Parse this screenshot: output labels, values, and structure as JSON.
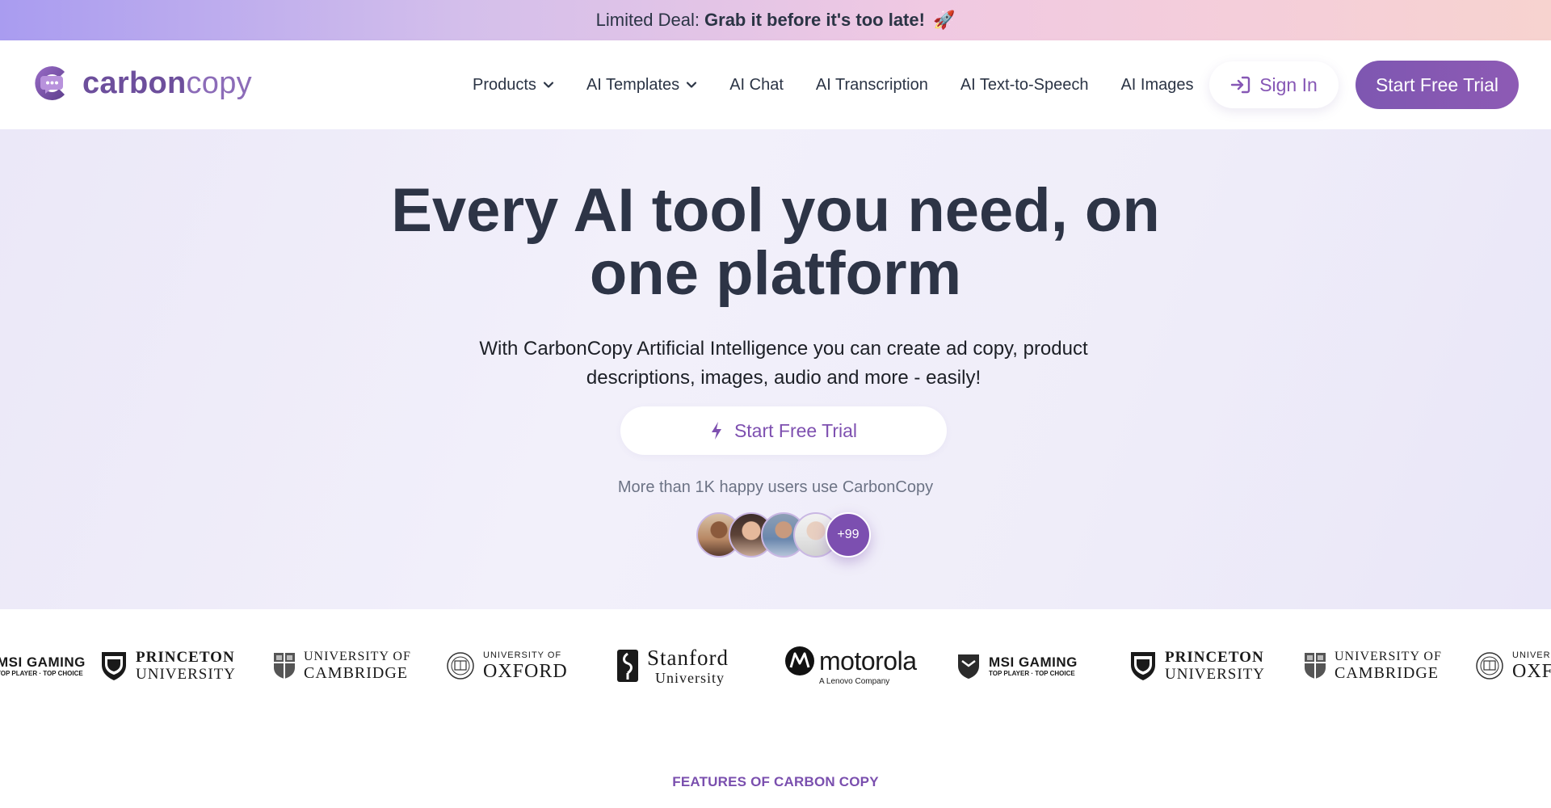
{
  "promo": {
    "prefix": "Limited Deal:",
    "highlight": "Grab it before it's too late!",
    "emoji": "🚀"
  },
  "header": {
    "logo_bold": "carbon",
    "logo_light": "copy",
    "nav": [
      {
        "label": "Products",
        "has_dropdown": true
      },
      {
        "label": "AI Templates",
        "has_dropdown": true
      },
      {
        "label": "AI Chat",
        "has_dropdown": false
      },
      {
        "label": "AI Transcription",
        "has_dropdown": false
      },
      {
        "label": "AI Text-to-Speech",
        "has_dropdown": false
      },
      {
        "label": "AI Images",
        "has_dropdown": false
      }
    ],
    "sign_in": "Sign In",
    "start_trial": "Start Free Trial"
  },
  "hero": {
    "title_line1": "Every AI tool you need, on",
    "title_line2": "one platform",
    "subtitle": "With CarbonCopy Artificial Intelligence you can create ad copy, product descriptions, images, audio and more - easily!",
    "cta": "Start Free Trial",
    "users_text": "More than 1K happy users use CarbonCopy",
    "more_users": "+99"
  },
  "logos": {
    "msi_main": "MSI GAMING",
    "msi_sub": "TOP PLAYER · TOP CHOICE",
    "princeton_l1": "PRINCETON",
    "princeton_l2": "UNIVERSITY",
    "cambridge_l1": "UNIVERSITY OF",
    "cambridge_l2": "CAMBRIDGE",
    "oxford_l1": "UNIVERSITY OF",
    "oxford_l2": "OXFORD",
    "stanford_l1": "Stanford",
    "stanford_l2": "University",
    "motorola_main": "motorola",
    "motorola_sub": "A Lenovo Company"
  },
  "features": {
    "label": "FEATURES OF CARBON COPY"
  },
  "colors": {
    "brand_purple": "#7e57b1",
    "text_dark": "#2d3446"
  }
}
